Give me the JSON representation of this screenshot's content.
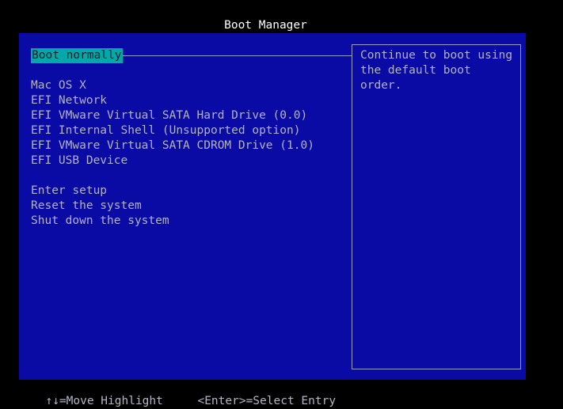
{
  "header": {
    "title": "Boot Manager"
  },
  "menu": {
    "selected": "Boot normally",
    "boot_items": [
      "Mac OS X",
      "EFI Network",
      "EFI VMware Virtual SATA Hard Drive (0.0)",
      "EFI Internal Shell (Unsupported option)",
      "EFI VMware Virtual SATA CDROM Drive (1.0)",
      "EFI USB Device"
    ],
    "system_items": [
      "Enter setup",
      "Reset the system",
      "Shut down the system"
    ]
  },
  "help": {
    "text": "Continue to boot using\nthe default boot order."
  },
  "footer": {
    "move_hint": "↑↓=Move Highlight",
    "select_hint": "<Enter>=Select Entry"
  },
  "colors": {
    "panel_bg": "#0a0aa4",
    "highlight_bg": "#00a8a8",
    "text": "#b4b4c4",
    "title": "#ffffff"
  }
}
